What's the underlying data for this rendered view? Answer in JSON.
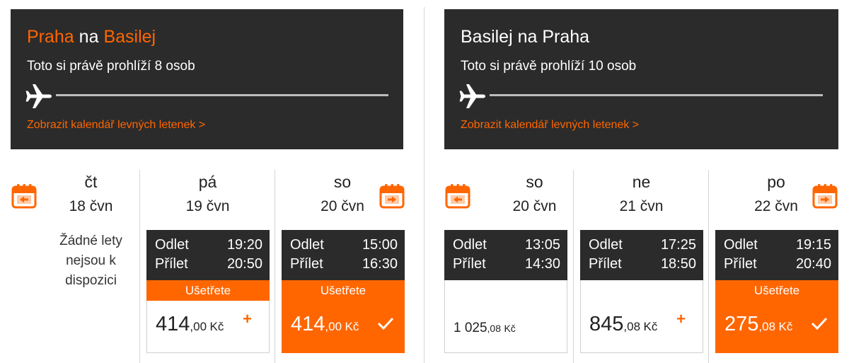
{
  "outbound": {
    "route": {
      "from": "Praha",
      "connector": "na",
      "to": "Basilej"
    },
    "viewers": "Toto si právě prohlíží 8 osob",
    "calendar_link": "Zobrazit kalendář levných letenek >",
    "prev_date_icon": "calendar-prev-icon",
    "next_date_icon": "calendar-next-icon",
    "days": [
      {
        "day": "čt",
        "date": "18 čvn",
        "no_flights": "Žádné lety nejsou k dispozici"
      },
      {
        "day": "pá",
        "date": "19 čvn",
        "depart_label": "Odlet",
        "depart": "19:20",
        "arrive_label": "Přílet",
        "arrive": "20:50",
        "save": "Ušetřete",
        "price_main": "414",
        "price_dec": ",00",
        "currency": "Kč",
        "selected": false
      },
      {
        "day": "so",
        "date": "20 čvn",
        "depart_label": "Odlet",
        "depart": "15:00",
        "arrive_label": "Přílet",
        "arrive": "16:30",
        "save": "Ušetřete",
        "price_main": "414",
        "price_dec": ",00",
        "currency": "Kč",
        "selected": true
      }
    ]
  },
  "inbound": {
    "route": {
      "from": "Basilej",
      "connector": "na",
      "to": "Praha"
    },
    "viewers": "Toto si právě prohlíží 10 osob",
    "calendar_link": "Zobrazit kalendář levných letenek >",
    "prev_date_icon": "calendar-prev-icon",
    "next_date_icon": "calendar-next-icon",
    "days": [
      {
        "day": "so",
        "date": "20 čvn",
        "depart_label": "Odlet",
        "depart": "13:05",
        "arrive_label": "Přílet",
        "arrive": "14:30",
        "price_main": "1 025",
        "price_dec": ",08",
        "currency": "Kč",
        "selected": false
      },
      {
        "day": "ne",
        "date": "21 čvn",
        "depart_label": "Odlet",
        "depart": "17:25",
        "arrive_label": "Přílet",
        "arrive": "18:50",
        "price_main": "845",
        "price_dec": ",08",
        "currency": "Kč",
        "selected": false
      },
      {
        "day": "po",
        "date": "22 čvn",
        "depart_label": "Odlet",
        "depart": "19:15",
        "arrive_label": "Přílet",
        "arrive": "20:40",
        "save": "Ušetřete",
        "price_main": "275",
        "price_dec": ",08",
        "currency": "Kč",
        "selected": true
      }
    ]
  },
  "colors": {
    "accent": "#ff6600",
    "dark": "#2b2b2b",
    "border": "#cfcfcf"
  }
}
